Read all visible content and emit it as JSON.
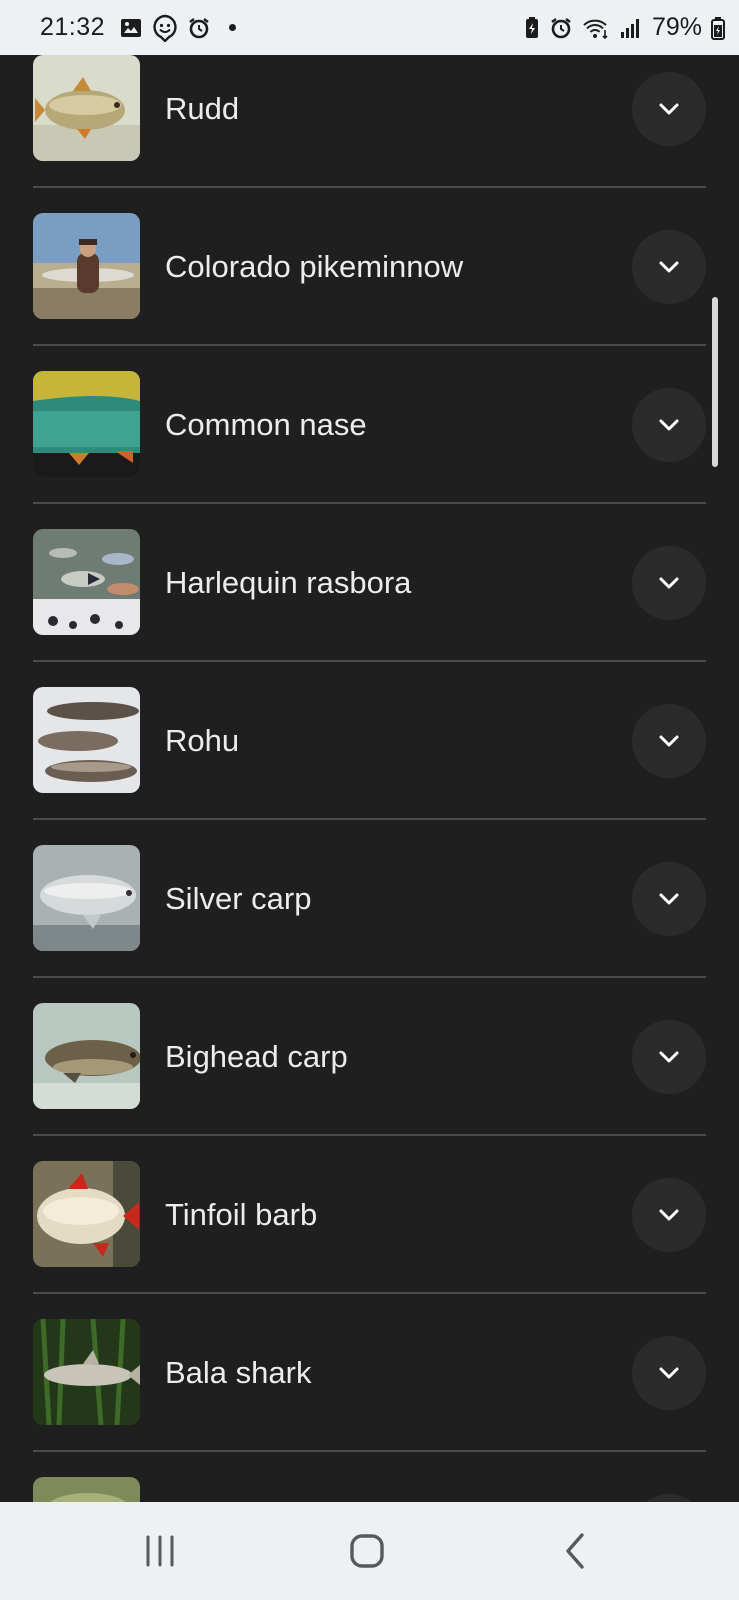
{
  "status_bar": {
    "time": "21:32",
    "battery_percent": "79%",
    "left_icons": [
      "gallery-icon",
      "smiley-badge-icon",
      "alarm-icon",
      "notification-dot"
    ],
    "right_icons": [
      "battery-saver-icon",
      "alarm-icon",
      "wifi-icon",
      "signal-icon",
      "battery-icon"
    ]
  },
  "fish_list": [
    {
      "name": "Rudd",
      "thumb": "rudd-thumbnail"
    },
    {
      "name": "Colorado pikeminnow",
      "thumb": "colorado-pikeminnow-thumbnail"
    },
    {
      "name": "Common nase",
      "thumb": "common-nase-thumbnail"
    },
    {
      "name": "Harlequin rasbora",
      "thumb": "harlequin-rasbora-thumbnail"
    },
    {
      "name": "Rohu",
      "thumb": "rohu-thumbnail"
    },
    {
      "name": "Silver carp",
      "thumb": "silver-carp-thumbnail"
    },
    {
      "name": "Bighead carp",
      "thumb": "bighead-carp-thumbnail"
    },
    {
      "name": "Tinfoil barb",
      "thumb": "tinfoil-barb-thumbnail"
    },
    {
      "name": "Bala shark",
      "thumb": "bala-shark-thumbnail"
    },
    {
      "name": "",
      "thumb": "partial-thumbnail"
    }
  ],
  "nav_bar": {
    "recent": "recent-apps-icon",
    "home": "home-icon",
    "back": "back-icon"
  },
  "colors": {
    "background": "#1f1f1f",
    "text": "#ececec",
    "button_bg": "#2b2b2b",
    "divider": "#4a4a4a",
    "system_bar": "#eef1f3"
  }
}
